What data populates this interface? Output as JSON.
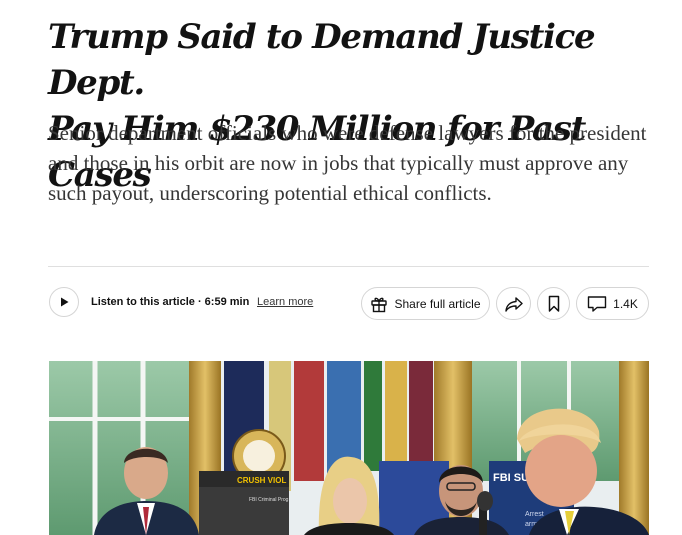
{
  "article": {
    "headline_line1": "Trump Said to Demand Justice Dept.",
    "headline_line2": "Pay Him $230 Million for Past Cases",
    "dek": "Senior department officials who were defense lawyers for the president and those in his orbit are now in jobs that typically must approve any such payout, underscoring potential ethical conflicts."
  },
  "toolbar": {
    "listen_label": "Listen to this article · 6:59 min",
    "learn_more": "Learn more",
    "share_full_article": "Share full article",
    "comments_count": "1.4K",
    "icons": [
      "play-icon",
      "gift-icon",
      "share-arrow-icon",
      "bookmark-icon",
      "comment-icon"
    ]
  },
  "photo": {
    "sign_text_1": "CRUSH VIOL",
    "sign_text_2": "FBI Criminal Prog",
    "sign_text_3": "FBI SUM",
    "sign_text_4": "Arrest",
    "sign_text_5": "arms"
  }
}
